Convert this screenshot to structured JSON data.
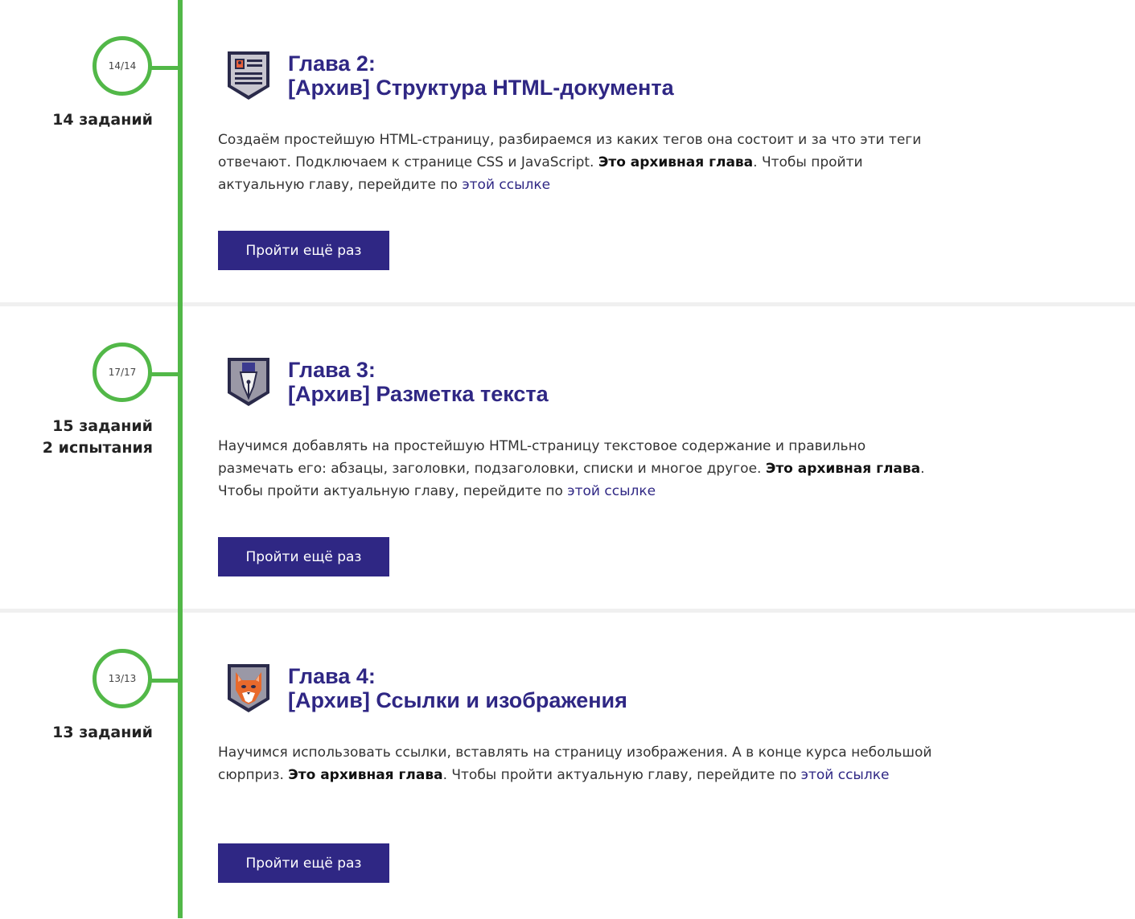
{
  "chapters": [
    {
      "progress": "14/14",
      "counts": [
        "14 заданий"
      ],
      "title_line1": "Глава 2:",
      "title_line2": "[Архив] Структура HTML-документа",
      "icon": "document-icon",
      "desc_text": "Создаём простейшую HTML-страницу, разбираемся из каких тегов она состоит и за что эти теги отвечают. Подключаем к странице CSS и JavaScript.",
      "desc_bold": "Это архивная глава",
      "desc_after": ". Чтобы пройти актуальную главу, перейдите по",
      "link_text": "этой ссылке",
      "button_label": "Пройти ещё раз"
    },
    {
      "progress": "17/17",
      "counts": [
        "15 заданий",
        "2 испытания"
      ],
      "title_line1": "Глава 3:",
      "title_line2": "[Архив] Разметка текста",
      "icon": "pen-nib-icon",
      "desc_text": "Научимся добавлять на простейшую HTML-страницу текстовое содержание и правильно размечать его: абзацы, заголовки, подзаголовки, списки и многое другое.",
      "desc_bold": "Это архивная глава",
      "desc_after": ". Чтобы пройти актуальную главу, перейдите по",
      "link_text": "этой ссылке",
      "button_label": "Пройти ещё раз"
    },
    {
      "progress": "13/13",
      "counts": [
        "13 заданий"
      ],
      "title_line1": "Глава 4:",
      "title_line2": "[Архив] Ссылки и изображения",
      "icon": "cat-icon",
      "desc_text": "Научимся использовать ссылки, вставлять на страницу изображения. А в конце курса небольшой сюрприз.",
      "desc_bold": "Это архивная глава",
      "desc_after": ". Чтобы пройти актуальную главу, перейдите по",
      "link_text": "этой ссылке",
      "button_label": "Пройти ещё раз"
    }
  ],
  "colors": {
    "accent_green": "#52b848",
    "brand_purple": "#2f2784"
  }
}
